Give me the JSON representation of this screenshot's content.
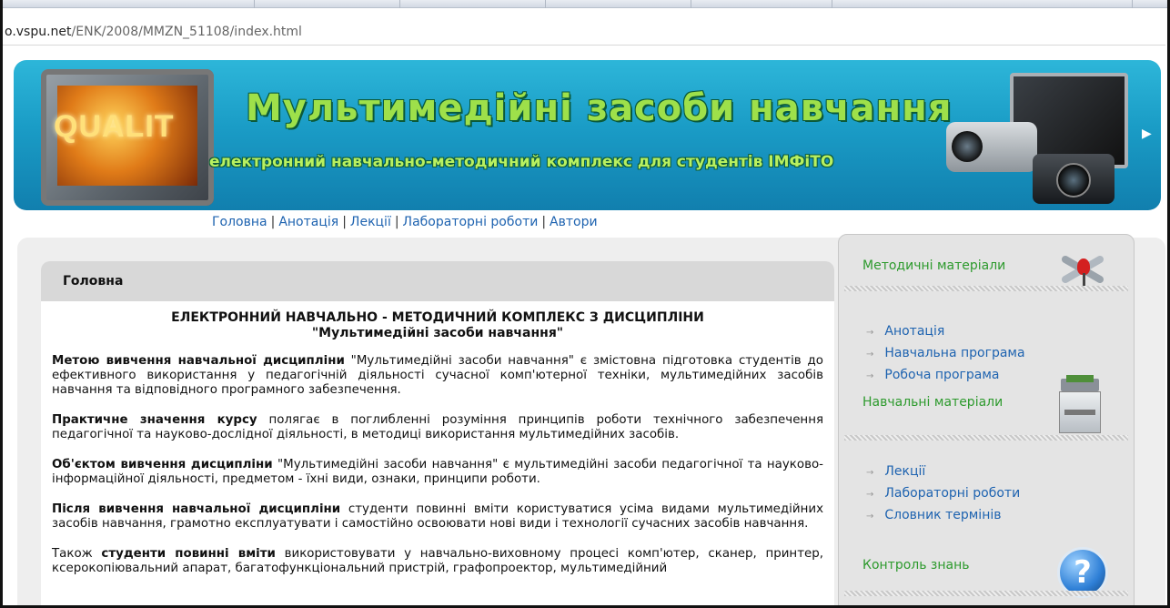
{
  "browser": {
    "url_host": "o.vspu.net",
    "url_path": "/ENK/2008/MMZN_51108/index.html"
  },
  "banner": {
    "logo_text": "QUALIT",
    "title": "Мультимедійні засоби навчання",
    "subtitle": "електронний навчально-методичний комплекс для студентів ІМФіТО"
  },
  "nav": {
    "items": [
      {
        "label": "Головна"
      },
      {
        "label": "Анотація"
      },
      {
        "label": "Лекції"
      },
      {
        "label": "Лабораторні роботи"
      },
      {
        "label": "Автори"
      }
    ],
    "separator": "|"
  },
  "main": {
    "header": "Головна",
    "heading_line1": "ЕЛЕКТРОННИЙ НАВЧАЛЬНО - МЕТОДИЧНИЙ КОМПЛЕКС З ДИСЦИПЛІНИ",
    "heading_line2": "\"Мультимедійні засоби навчання\"",
    "paragraphs": [
      {
        "bold": "Метою вивчення навчальної дисципліни",
        "text": " \"Мультимедійні засоби навчання\" є змістовна підготовка студентів до ефективного використання у педагогічній діяльності сучасної комп'ютерної техніки, мультимедійних засобів навчання та відповідного програмного забезпечення."
      },
      {
        "bold": "Практичне значення курсу",
        "text": " полягає в поглибленні розуміння принципів роботи технічного забезпечення педагогічної та науково-дослідної діяльності, в методиці використання мультимедійних засобів."
      },
      {
        "bold": "Об'єктом вивчення дисципліни",
        "text": " \"Мультимедійні засоби навчання\" є мультимедійні засоби педагогічної та науково-інформаційної діяльності, предметом - їхні види, ознаки, принципи роботи."
      },
      {
        "bold": "Після вивчення навчальної дисципліни",
        "text": " студенти повинні вміти користуватися усіма видами мультимедійних засобів навчання, грамотно експлуатувати і самостійно освоювати нові види і технології сучасних засобів навчання."
      },
      {
        "prefix": "Також ",
        "bold": "студенти повинні вміти",
        "text": " використовувати у навчально-виховному процесі комп'ютер, сканер, принтер, ксерокопіювальний апарат, багатофункціональний пристрій, графопроектор, мультимедійний"
      }
    ]
  },
  "sidebar": {
    "sections": [
      {
        "title": "Методичні матеріали",
        "icon": "pins-icon",
        "items": [
          "Анотація",
          "Навчальна програма",
          "Робоча програма"
        ]
      },
      {
        "title": "Навчальні матеріали",
        "icon": "copier-icon",
        "items": [
          "Лекції",
          "Лабораторні роботи",
          "Словник термінів"
        ]
      },
      {
        "title": "Контроль знань",
        "icon": "help-icon",
        "icon_glyph": "?",
        "items": []
      }
    ],
    "bullet": "→"
  },
  "colors": {
    "banner": "#1a9cc6",
    "title_green": "#9ee04a",
    "link": "#1e63b0",
    "sidebar_heading": "#2d9a2d"
  }
}
